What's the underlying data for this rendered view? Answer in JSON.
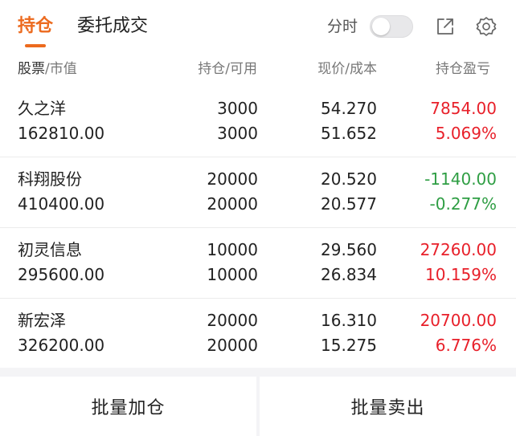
{
  "tabs": {
    "active": "持仓",
    "inactive": "委托成交"
  },
  "toolbar": {
    "fenshi_label": "分时",
    "fenshi_on": false,
    "share_icon": "share-icon",
    "settings_icon": "gear-icon"
  },
  "header": {
    "stock": "股票",
    "sep1": "/",
    "market_value": "市值",
    "position": "持仓/可用",
    "price": "现价/成本",
    "profit": "持仓盈亏"
  },
  "rows": [
    {
      "name": "久之洋",
      "market_value": "162810.00",
      "position": "3000",
      "available": "3000",
      "price": "54.270",
      "cost": "51.652",
      "profit": "7854.00",
      "profit_pct": "5.069%",
      "trend": "up"
    },
    {
      "name": "科翔股份",
      "market_value": "410400.00",
      "position": "20000",
      "available": "20000",
      "price": "20.520",
      "cost": "20.577",
      "profit": "-1140.00",
      "profit_pct": "-0.277%",
      "trend": "down"
    },
    {
      "name": "初灵信息",
      "market_value": "295600.00",
      "position": "10000",
      "available": "10000",
      "price": "29.560",
      "cost": "26.834",
      "profit": "27260.00",
      "profit_pct": "10.159%",
      "trend": "up"
    },
    {
      "name": "新宏泽",
      "market_value": "326200.00",
      "position": "20000",
      "available": "20000",
      "price": "16.310",
      "cost": "15.275",
      "profit": "20700.00",
      "profit_pct": "6.776%",
      "trend": "up"
    }
  ],
  "buttons": {
    "batch_add": "批量加仓",
    "batch_sell": "批量卖出"
  },
  "colors": {
    "accent": "#ec6a1e",
    "profit_up": "#e8202a",
    "profit_down": "#2f9e44"
  }
}
